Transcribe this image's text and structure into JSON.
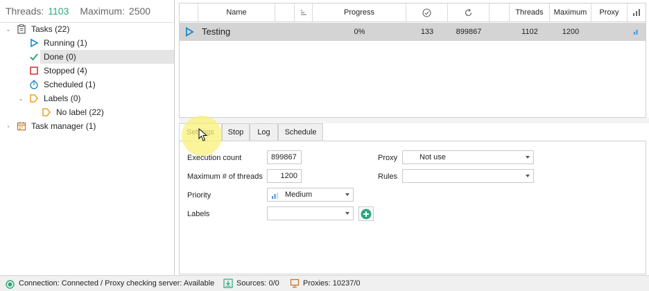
{
  "threads_bar": {
    "threads_label": "Threads:",
    "threads_value": "1103",
    "maximum_label": "Maximum:",
    "maximum_value": "2500"
  },
  "tree": {
    "tasks": "Tasks (22)",
    "running": "Running (1)",
    "done": "Done (0)",
    "stopped": "Stopped (4)",
    "scheduled": "Scheduled (1)",
    "labels": "Labels (0)",
    "no_label": "No label (22)",
    "task_manager": "Task manager (1)"
  },
  "grid": {
    "headers": {
      "name": "Name",
      "progress": "Progress",
      "threads": "Threads",
      "maximum": "Maximum",
      "proxy": "Proxy"
    },
    "rows": [
      {
        "name": "Testing",
        "progress": "0%",
        "completed": "133",
        "repeat": "899867",
        "threads": "1102",
        "maximum": "1200"
      }
    ]
  },
  "tabs": {
    "settings": "Settings",
    "stop": "Stop",
    "log": "Log",
    "schedule": "Schedule"
  },
  "settings": {
    "execution_count_label": "Execution count",
    "execution_count_value": "899867",
    "max_threads_label": "Maximum # of threads",
    "max_threads_value": "1200",
    "priority_label": "Priority",
    "priority_value": "Medium",
    "labels_label": "Labels",
    "labels_value": "",
    "proxy_label": "Proxy",
    "proxy_value": "Not use",
    "rules_label": "Rules",
    "rules_value": ""
  },
  "status": {
    "connection": "Connection: Connected / Proxy checking server: Available",
    "sources": "Sources: 0/0",
    "proxies": "Proxies: 10237/0"
  },
  "colors": {
    "accent_green": "#2aa87a",
    "play_blue": "#1e88c8",
    "stopped_red": "#d23a3a",
    "label_orange": "#e8a020"
  }
}
